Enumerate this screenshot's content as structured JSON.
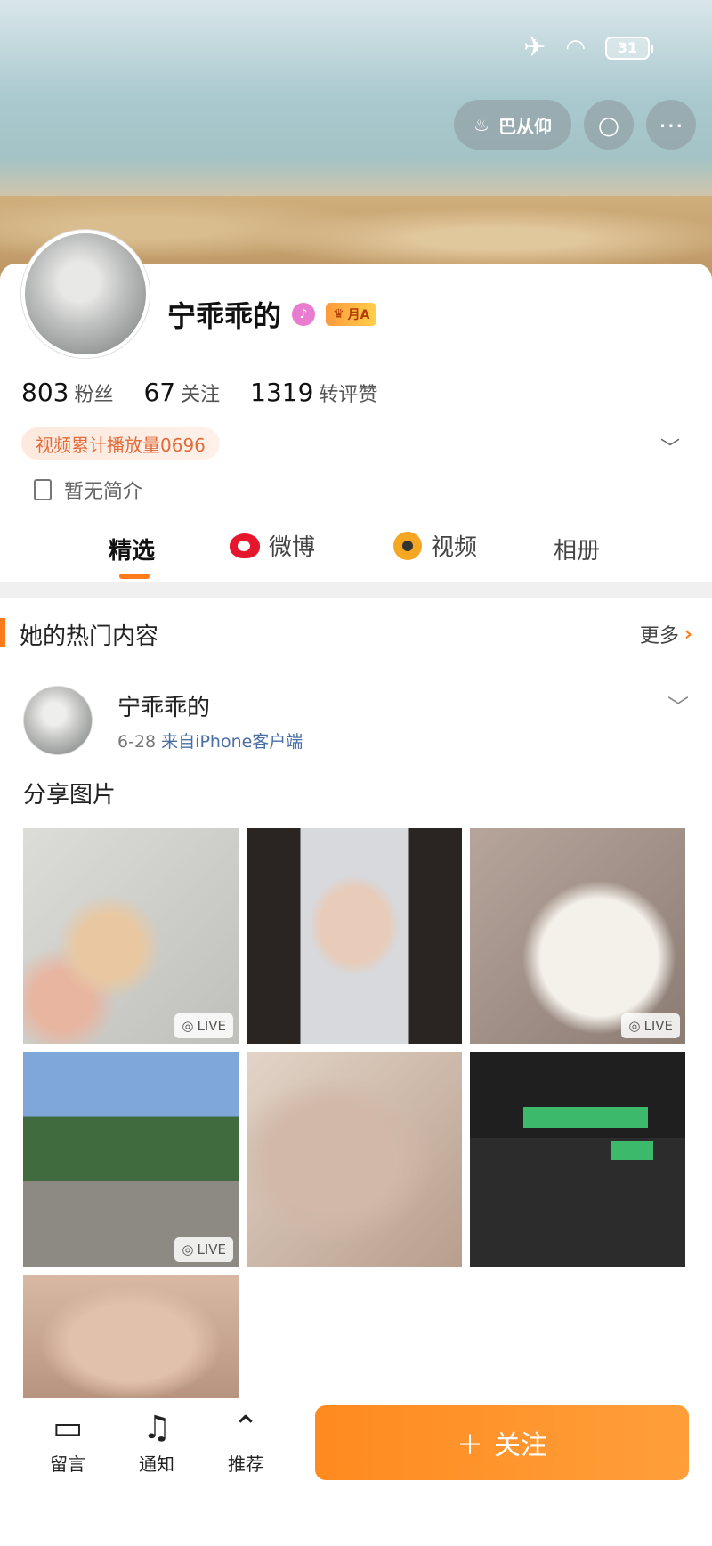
{
  "status_bar": {
    "battery": "31"
  },
  "top_actions": {
    "pill_label": "巴从仰"
  },
  "profile": {
    "name": "宁乖乖的",
    "level_badge": "月A",
    "stats": [
      {
        "num": "803",
        "label": "粉丝"
      },
      {
        "num": "67",
        "label": "关注"
      },
      {
        "num": "1319",
        "label": "转评赞"
      }
    ],
    "play_count": "视频累计播放量0696",
    "bio": "暂无简介"
  },
  "tabs": [
    {
      "label": "精选"
    },
    {
      "label": "微博"
    },
    {
      "label": "视频"
    },
    {
      "label": "相册"
    }
  ],
  "hot_section": {
    "title": "她的热门内容",
    "more_label": "更多"
  },
  "post": {
    "author": "宁乖乖的",
    "date": "6-28",
    "source": "来自iPhone客户端",
    "text": "分享图片",
    "live_label": "LIVE"
  },
  "bottom_bar": {
    "items": [
      {
        "label": "留言"
      },
      {
        "label": "通知"
      },
      {
        "label": "推荐"
      }
    ],
    "follow_label": "关注"
  }
}
